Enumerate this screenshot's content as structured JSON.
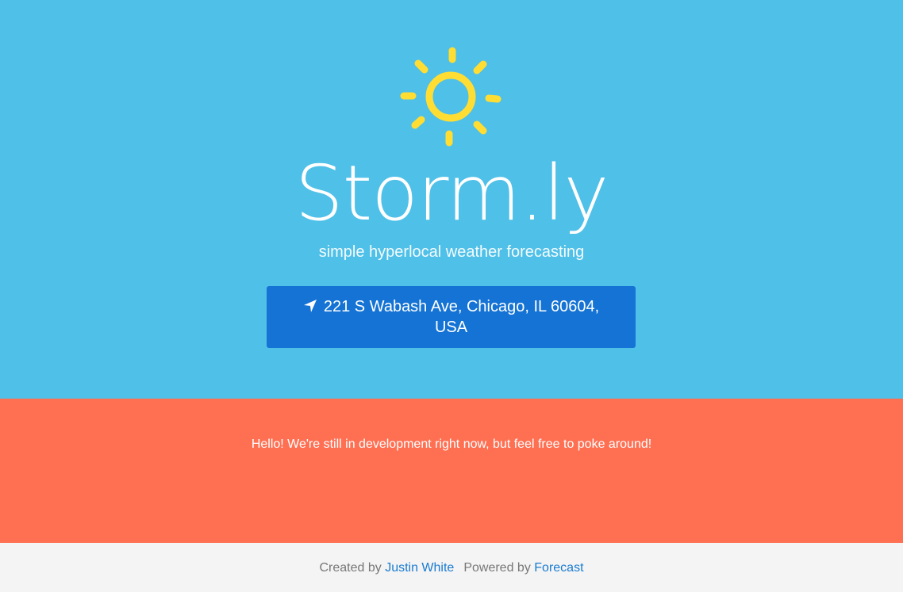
{
  "app": {
    "brand": "Storm.ly",
    "tagline": "simple hyperlocal weather forecasting"
  },
  "location": {
    "label": "221 S Wabash Ave, Chicago, IL 60604, USA",
    "icon": "location-arrow-icon"
  },
  "notice": {
    "message": "Hello! We're still in development right now, but feel free to poke around!"
  },
  "footer": {
    "created_by_prefix": "Created by",
    "author": "Justin White",
    "powered_by_prefix": "Powered by",
    "provider": "Forecast"
  },
  "colors": {
    "hero_bg": "#4fc0e8",
    "sun": "#ffdd33",
    "button_bg": "#1473d4",
    "notice_bg": "#ff7053",
    "footer_bg": "#f4f4f4",
    "link": "#1a7bd0"
  }
}
